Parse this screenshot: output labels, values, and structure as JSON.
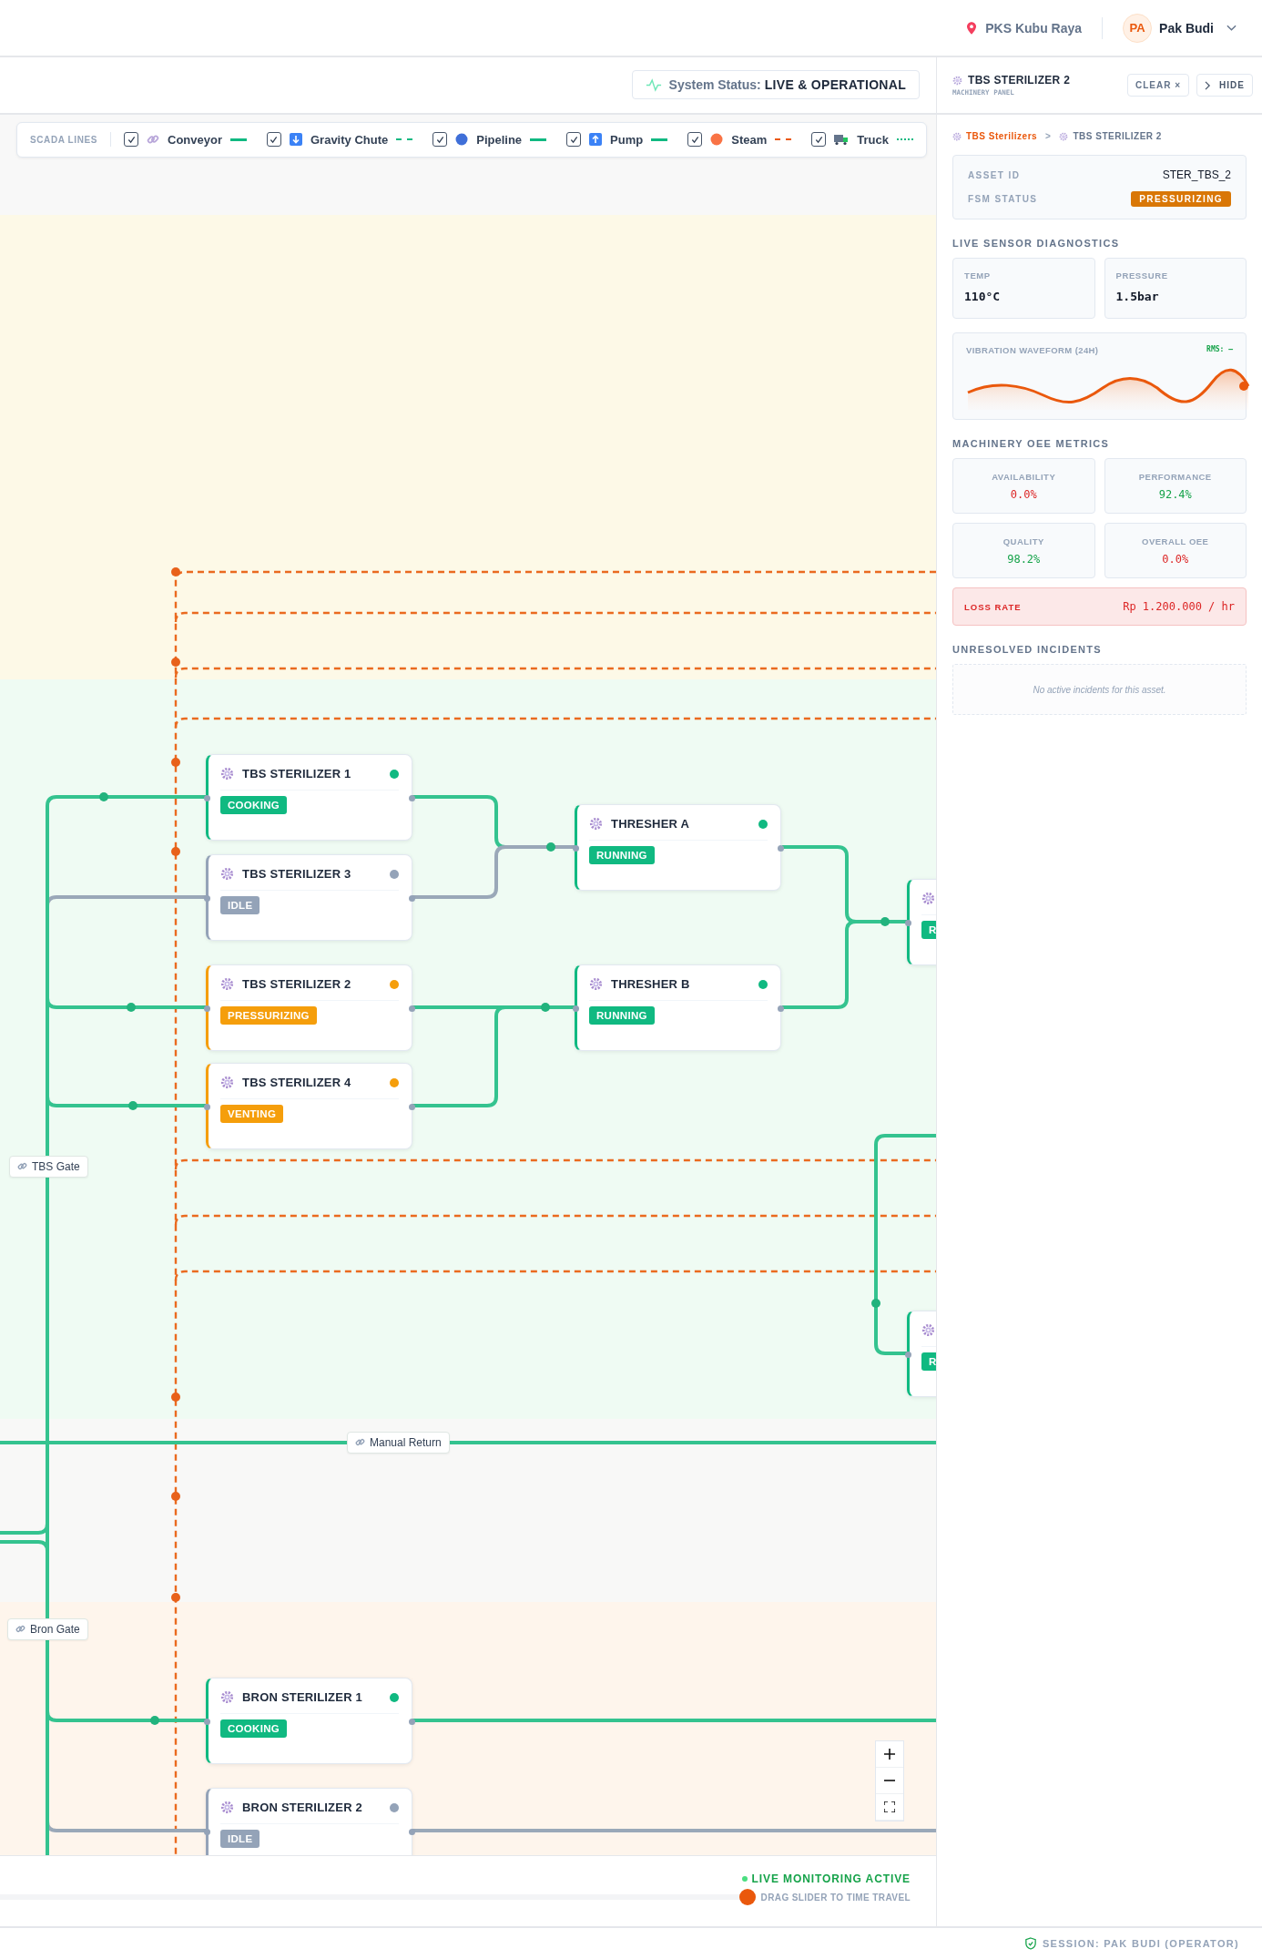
{
  "header": {
    "location": "PKS Kubu Raya",
    "user": {
      "initials": "PA",
      "name": "Pak Budi"
    }
  },
  "system_status": {
    "label": "System Status:",
    "value": "LIVE & OPERATIONAL"
  },
  "legend": {
    "title": "SCADA LINES",
    "items": [
      {
        "label": "Conveyor",
        "checked": true,
        "kind": "solid",
        "color": "#10b981"
      },
      {
        "label": "Gravity Chute",
        "checked": true,
        "kind": "dashed",
        "color": "#10b981"
      },
      {
        "label": "Pipeline",
        "checked": true,
        "kind": "solid",
        "color": "#10b981"
      },
      {
        "label": "Pump",
        "checked": true,
        "kind": "solid",
        "color": "#10b981"
      },
      {
        "label": "Steam",
        "checked": true,
        "kind": "dashed",
        "color": "#ea580c"
      },
      {
        "label": "Truck",
        "checked": true,
        "kind": "dotted",
        "color": "#10b981"
      }
    ]
  },
  "nodes": [
    {
      "kind": "full",
      "name": "TBS STERILIZER 1",
      "status": "COOKING",
      "color": "#10b981"
    },
    {
      "kind": "full",
      "name": "TBS STERILIZER 3",
      "status": "IDLE",
      "color": "#94a3b8"
    },
    {
      "kind": "full",
      "name": "TBS STERILIZER 2",
      "status": "PRESSURIZING",
      "color": "#f59e0b"
    },
    {
      "kind": "full",
      "name": "TBS STERILIZER 4",
      "status": "VENTING",
      "color": "#f59e0b"
    },
    {
      "kind": "full",
      "name": "THRESHER A",
      "status": "RUNNING",
      "color": "#10b981"
    },
    {
      "kind": "full",
      "name": "THRESHER B",
      "status": "RUNNING",
      "color": "#10b981"
    },
    {
      "kind": "partial",
      "status": "R",
      "color": "#10b981"
    },
    {
      "kind": "partial",
      "status": "R",
      "color": "#10b981"
    },
    {
      "kind": "full",
      "name": "BRON STERILIZER 1",
      "status": "COOKING",
      "color": "#10b981"
    },
    {
      "kind": "full",
      "name": "BRON STERILIZER 2",
      "status": "IDLE",
      "color": "#94a3b8"
    }
  ],
  "edge_labels": [
    {
      "label": "TBS Gate"
    },
    {
      "label": "Manual Return"
    },
    {
      "label": "Bron Gate"
    }
  ],
  "footer": {
    "live": "LIVE MONITORING ACTIVE",
    "slider": {
      "level": 1
    },
    "hint": "DRAG SLIDER TO TIME TRAVEL"
  },
  "panel": {
    "title": "TBS STERILIZER 2",
    "subtitle": "MACHINERY PANEL",
    "clear": "CLEAR ×",
    "hide": "HIDE",
    "breadcrumb": [
      {
        "label": "TBS Sterilizers",
        "current": false
      },
      {
        "label": "TBS STERILIZER 2",
        "current": true
      }
    ],
    "separator": ">",
    "asset": {
      "id_label": "ASSET ID",
      "id": "STER_TBS_2",
      "status_label": "FSM STATUS",
      "status": "PRESSURIZING",
      "color": "#d97706"
    },
    "sensors_title": "LIVE SENSOR DIAGNOSTICS",
    "sensors": [
      {
        "label": "TEMP",
        "value": "110°C"
      },
      {
        "label": "PRESSURE",
        "value": "1.5bar"
      }
    ],
    "waveform": {
      "title": "VIBRATION WAVEFORM (24H)",
      "rms": "RMS: –"
    },
    "oee_title": "MACHINERY OEE METRICS",
    "oee": [
      {
        "label": "AVAILABILITY",
        "value": "0.0%",
        "color": "#dc2626"
      },
      {
        "label": "PERFORMANCE",
        "value": "92.4%",
        "color": "#16a34a"
      },
      {
        "label": "QUALITY",
        "value": "98.2%",
        "color": "#16a34a"
      },
      {
        "label": "OVERALL OEE",
        "value": "0.0%",
        "color": "#dc2626"
      }
    ],
    "loss": {
      "label": "LOSS RATE",
      "value": "Rp 1.200.000 / hr"
    },
    "incidents_title": "UNRESOLVED INCIDENTS",
    "incidents_empty": "No active incidents for this asset."
  },
  "status_bar": {
    "session": "SESSION: PAK BUDI (OPERATOR)"
  }
}
